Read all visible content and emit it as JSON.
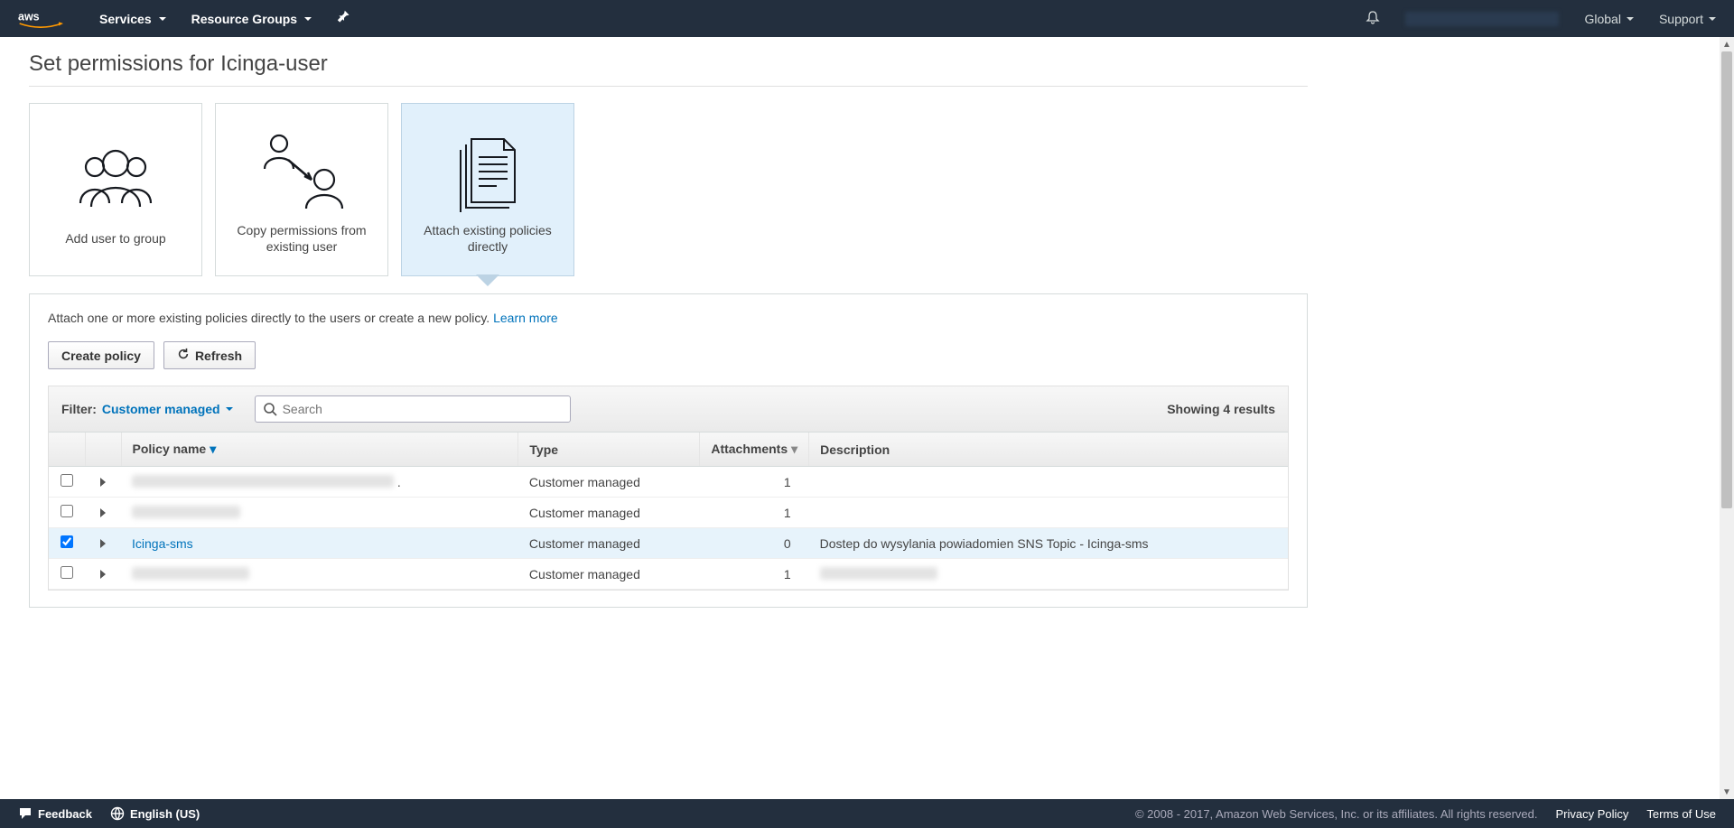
{
  "nav": {
    "services": "Services",
    "resource_groups": "Resource Groups",
    "region": "Global",
    "support": "Support"
  },
  "page": {
    "title": "Set permissions for Icinga-user"
  },
  "cards": {
    "add_group": "Add user to group",
    "copy_perms": "Copy permissions from existing user",
    "attach_direct": "Attach existing policies directly"
  },
  "panel": {
    "desc_text": "Attach one or more existing policies directly to the users or create a new policy. ",
    "learn_more": "Learn more",
    "create_policy": "Create policy",
    "refresh": "Refresh"
  },
  "filter": {
    "label": "Filter:",
    "value": "Customer managed",
    "search_placeholder": "Search",
    "results": "Showing 4 results"
  },
  "columns": {
    "policy_name": "Policy name",
    "type": "Type",
    "attachments": "Attachments",
    "description": "Description"
  },
  "rows": [
    {
      "checked": false,
      "name": "",
      "name_hidden": true,
      "name_blur_width": 290,
      "type": "Customer managed",
      "attachments": "1",
      "description": "",
      "desc_hidden": false
    },
    {
      "checked": false,
      "name": "",
      "name_hidden": true,
      "name_blur_width": 120,
      "type": "Customer managed",
      "attachments": "1",
      "description": "",
      "desc_hidden": false
    },
    {
      "checked": true,
      "name": "Icinga-sms",
      "name_hidden": false,
      "type": "Customer managed",
      "attachments": "0",
      "description": "Dostep do wysylania powiadomien SNS Topic - Icinga-sms",
      "desc_hidden": false
    },
    {
      "checked": false,
      "name": "",
      "name_hidden": true,
      "name_blur_width": 130,
      "type": "Customer managed",
      "attachments": "1",
      "description": "",
      "desc_hidden": true,
      "desc_blur_width": 130
    }
  ],
  "footer": {
    "feedback": "Feedback",
    "language": "English (US)",
    "copyright": "© 2008 - 2017, Amazon Web Services, Inc. or its affiliates. All rights reserved.",
    "privacy": "Privacy Policy",
    "terms": "Terms of Use"
  }
}
